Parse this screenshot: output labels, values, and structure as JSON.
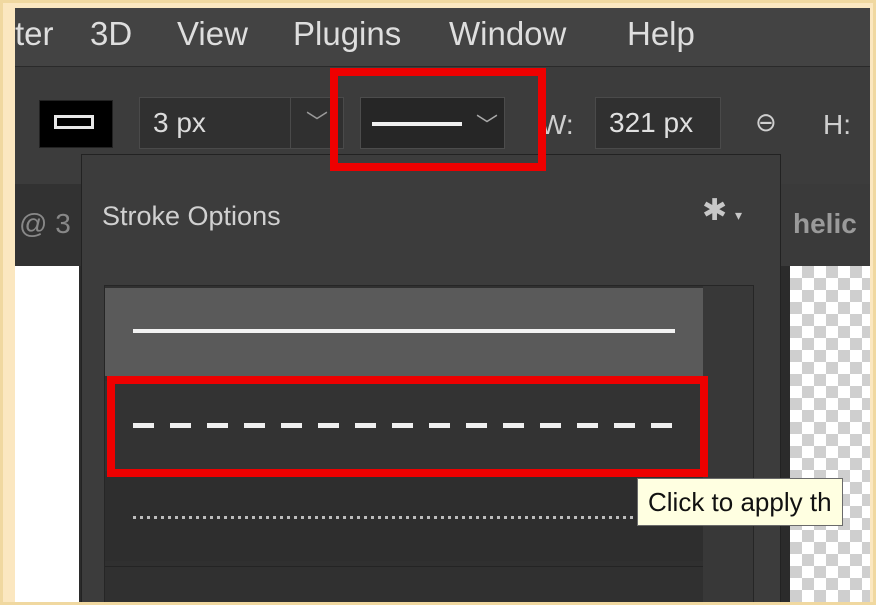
{
  "menu": {
    "items": [
      "ter",
      "3D",
      "View",
      "Plugins",
      "Window",
      "Help"
    ]
  },
  "options_bar": {
    "stroke_width": "3 px",
    "stroke_width_chevron": "﹀",
    "stroke_type_chevron": "﹀",
    "w_label": "W:",
    "w_value": "321 px",
    "link_icon": "link-icon",
    "h_label": "H:"
  },
  "tabs": {
    "left": "@ 3",
    "right": "helic"
  },
  "panel": {
    "title": "Stroke Options",
    "gear_icon": "gear-icon",
    "options": [
      "solid",
      "dashed",
      "dotted"
    ],
    "selected": "solid",
    "hovered": "dashed"
  },
  "tooltip": {
    "text": "Click to apply th"
  },
  "colors": {
    "highlight": "#ee0000",
    "tooltip_bg": "#ffffe1",
    "page_bg": "#fbe7c0"
  }
}
